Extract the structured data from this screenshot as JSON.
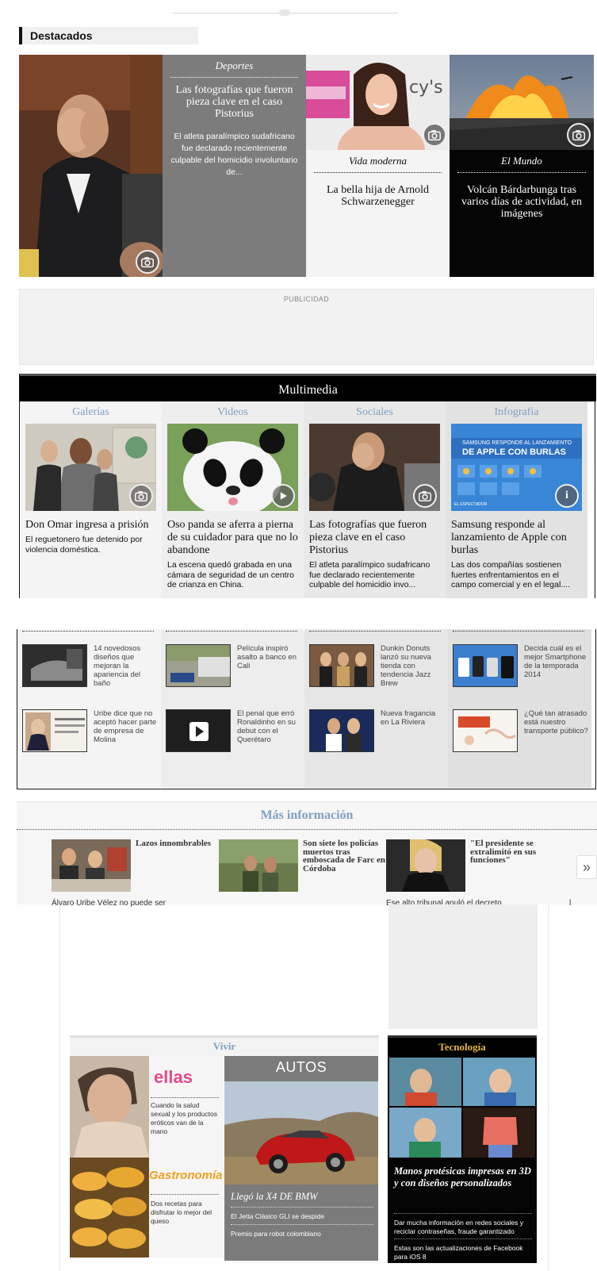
{
  "destacados": {
    "title": "Destacados",
    "card1": {
      "category": "Deportes",
      "title": "Las fotografías que fueron pieza clave en el caso Pistorius",
      "desc": "El atleta paralímpico sudafricano fue declarado recientemente culpable del homicidio involuntario de..."
    },
    "card2": {
      "category": "Vida moderna",
      "title": "La bella hija de Arnold Schwarzenegger"
    },
    "card3": {
      "category": "El Mundo",
      "title": "Volcán Bárdarbunga tras varios días de actividad, en imágenes"
    }
  },
  "ad": {
    "label": "PUBLICIDAD"
  },
  "multimedia": {
    "title": "Multimedia",
    "columns": [
      {
        "tab": "Galerías",
        "title": "Don Omar ingresa a prisión",
        "desc": "El reguetonero fue detenido por violencia doméstica.",
        "icon": "camera-icon"
      },
      {
        "tab": "Videos",
        "title": "Oso panda se aferra a pierna de su cuidador para que no lo abandone",
        "desc": "La escena quedó grabada en una cámara de seguridad de un centro de crianza en China.",
        "icon": "play-icon"
      },
      {
        "tab": "Sociales",
        "title": "Las fotografías que fueron pieza clave en el caso Pistorius",
        "desc": "El atleta paralímpico sudafricano fue declarado recientemente culpable del homicidio invo...",
        "icon": "camera-icon"
      },
      {
        "tab": "Infografía",
        "title": "Samsung responde al lanzamiento de Apple con burlas",
        "desc": "Las dos compañías sostienen fuertes enfrentamientos en el campo comercial y en el legal....",
        "icon": "info-icon",
        "image_text": {
          "banner_top": "SAMSUNG RESPONDE AL LANZAMIENTO",
          "banner_main": "DE APPLE CON BURLAS",
          "footer": "EL ESPECTADOR"
        }
      }
    ]
  },
  "small_grid": {
    "columns": [
      {
        "items": [
          "14 novedosos diseños que mejoran la apariencia del baño",
          "Uribe dice que no aceptó hacer parte de empresa de Molina"
        ]
      },
      {
        "items": [
          "Película inspiró asalto a banco en Cali",
          "El penal que erró Ronaldinho en su debut con el Querétaro"
        ]
      },
      {
        "items": [
          "Dunkin Donuts lanzó su nueva tienda con tendencia Jazz Brew",
          "Nueva fragancia en La Riviera"
        ]
      },
      {
        "items": [
          "Decida cuál es el mejor Smartphone de la temporada 2014",
          "¿Qué tan atrasado está nuestro transporte público?"
        ]
      }
    ]
  },
  "mas_info": {
    "title": "Más información",
    "items": [
      {
        "head": "Lazos innombrables",
        "desc": "Álvaro Uribe Vélez no puede ser"
      },
      {
        "head": "Son siete los policías muertos tras emboscada de Farc en Córdoba",
        "desc": ""
      },
      {
        "head": "\"El presidente se extralimitó en sus funciones\"",
        "desc": "Ese alto tribunal anuló el decreto"
      }
    ],
    "next_label": "»",
    "cut_letter": "l"
  },
  "vivir": {
    "title": "Vivir",
    "ellas_logo": "ellas",
    "ellas_text": "Cuando la salud sexual y los productos eróticos van de la mano",
    "gastro_logo": "Gastronomía",
    "gastro_text": "Dos recetas para disfrutar lo mejor del queso",
    "autos_label": "AUTOS",
    "autos_title": "Llegó la X4 DE BMW",
    "autos_links": [
      "El Jetta Clásico GLI se despide",
      "Premio para robot colombiano"
    ]
  },
  "tecnologia": {
    "title": "Tecnología",
    "story_title": "Manos protésicas impresas en 3D y con diseños personalizados",
    "links": [
      "Dar mucha información en redes sociales y reciclar contraseñas, fraude garantizado",
      "Estas son las actualizaciones de Facebook para iOS 8"
    ]
  }
}
